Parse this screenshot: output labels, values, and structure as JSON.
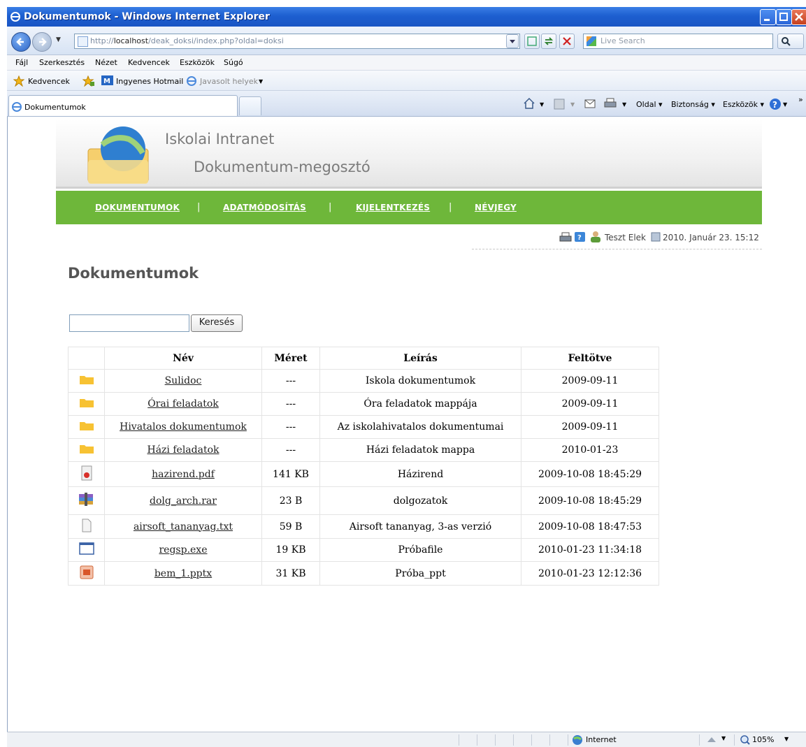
{
  "window": {
    "title": "Dokumentumok - Windows Internet Explorer"
  },
  "address": {
    "url_prefix": "http://",
    "url_host": "localhost",
    "url_path": "/deak_doksi/index.php?oldal=doksi",
    "search_placeholder": "Live Search"
  },
  "menu": [
    "Fájl",
    "Szerkesztés",
    "Nézet",
    "Kedvencek",
    "Eszközök",
    "Súgó"
  ],
  "favorites": {
    "label": "Kedvencek",
    "hotmail": "Ingyenes Hotmail",
    "suggested": "Javasolt helyek"
  },
  "tab": {
    "label": "Dokumentumok"
  },
  "commandbar": {
    "page": "Oldal",
    "safety": "Biztonság",
    "tools": "Eszközök",
    "more": "»"
  },
  "site": {
    "title": "Iskolai Intranet",
    "subtitle": "Dokumentum-megosztó",
    "nav": [
      "DOKUMENTUMOK",
      "ADATMÓDOSÍTÁS",
      "KIJELENTKEZÉS",
      "NÉVJEGY"
    ],
    "nav_separator": "|",
    "user": "Teszt Elek",
    "datetime": "2010. Január 23. 15:12"
  },
  "page": {
    "heading": "Dokumentumok",
    "search_button": "Keresés",
    "search_value": ""
  },
  "table": {
    "headers": [
      "Név",
      "Méret",
      "Leírás",
      "Feltötve"
    ],
    "rows": [
      {
        "icon": "folder",
        "name": "Sulidoc",
        "size": "---",
        "desc": "Iskola dokumentumok",
        "date": "2009-09-11"
      },
      {
        "icon": "folder",
        "name": "Órai feladatok",
        "size": "---",
        "desc": "Óra feladatok mappája",
        "date": "2009-09-11"
      },
      {
        "icon": "folder",
        "name": "Hivatalos dokumentumok",
        "size": "---",
        "desc": "Az iskolahivatalos dokumentumai",
        "date": "2009-09-11"
      },
      {
        "icon": "folder",
        "name": "Házi feladatok",
        "size": "---",
        "desc": "Házi feladatok mappa",
        "date": "2010-01-23"
      },
      {
        "icon": "pdf",
        "name": "hazirend.pdf",
        "size": "141 KB",
        "desc": "Házirend",
        "date": "2009-10-08 18:45:29"
      },
      {
        "icon": "rar",
        "name": "dolg_arch.rar",
        "size": "23 B",
        "desc": "dolgozatok",
        "date": "2009-10-08 18:45:29"
      },
      {
        "icon": "txt",
        "name": "airsoft_tananyag.txt",
        "size": "59 B",
        "desc": "Airsoft tananyag, 3-as verzió",
        "date": "2009-10-08 18:47:53"
      },
      {
        "icon": "exe",
        "name": "regsp.exe",
        "size": "19 KB",
        "desc": "Próbafile",
        "date": "2010-01-23 11:34:18"
      },
      {
        "icon": "pptx",
        "name": "bem_1.pptx",
        "size": "31 KB",
        "desc": "Próba_ppt",
        "date": "2010-01-23 12:12:36"
      }
    ]
  },
  "status": {
    "zone": "Internet",
    "zoom": "105%"
  },
  "colors": {
    "nav_green": "#6eb73a",
    "titlebar_blue": "#1d5fd0",
    "folder_yellow": "#f7c233"
  }
}
